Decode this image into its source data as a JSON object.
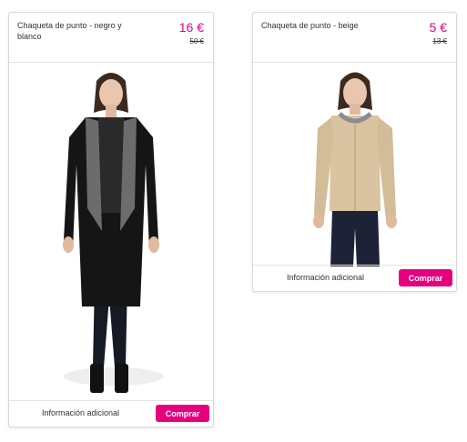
{
  "colors": {
    "accent": "#e5007e"
  },
  "products": [
    {
      "title": "Chaqueta de punto - negro y blanco",
      "price_now": "16 €",
      "price_old": "50 €",
      "info_label": "Información adicional",
      "buy_label": "Comprar"
    },
    {
      "title": "Chaqueta de punto - beige",
      "price_now": "5 €",
      "price_old": "13 €",
      "info_label": "Información adicional",
      "buy_label": "Comprar"
    }
  ]
}
